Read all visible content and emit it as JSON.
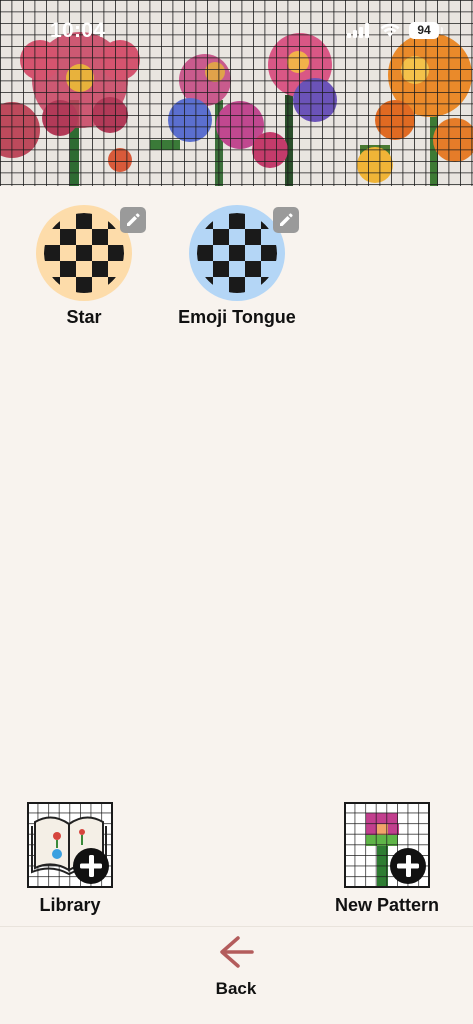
{
  "status_bar": {
    "time": "10:04",
    "battery": "94"
  },
  "patterns": [
    {
      "name": "Star",
      "accent": "#fddcaa"
    },
    {
      "name": "Emoji Tongue",
      "accent": "#b4d6f6"
    }
  ],
  "actions": {
    "library_label": "Library",
    "new_pattern_label": "New Pattern"
  },
  "nav": {
    "back_label": "Back",
    "back_color": "#b35c5c"
  },
  "icons": {
    "signal": "cellular-signal-icon",
    "wifi": "wifi-icon",
    "edit": "pencil-edit-icon",
    "back": "arrow-left-icon",
    "add": "plus-circle-icon"
  }
}
